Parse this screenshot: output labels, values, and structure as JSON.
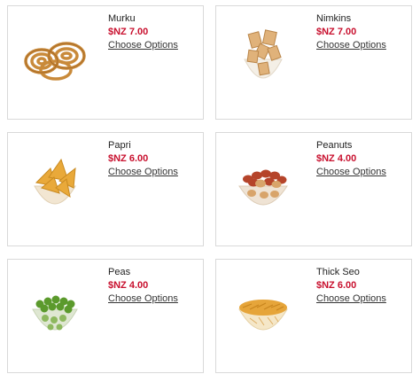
{
  "colors": {
    "price": "#c8102e",
    "border": "#d9d9d9"
  },
  "products": [
    {
      "name": "Murku",
      "price": "$NZ 7.00",
      "action": "Choose Options",
      "image": "murku-image"
    },
    {
      "name": "Nimkins",
      "price": "$NZ 7.00",
      "action": "Choose Options",
      "image": "nimkins-image"
    },
    {
      "name": "Papri",
      "price": "$NZ 6.00",
      "action": "Choose Options",
      "image": "papri-image"
    },
    {
      "name": "Peanuts",
      "price": "$NZ 4.00",
      "action": "Choose Options",
      "image": "peanuts-image"
    },
    {
      "name": "Peas",
      "price": "$NZ 4.00",
      "action": "Choose Options",
      "image": "peas-image"
    },
    {
      "name": "Thick Seo",
      "price": "$NZ 6.00",
      "action": "Choose Options",
      "image": "thick-seo-image"
    }
  ]
}
